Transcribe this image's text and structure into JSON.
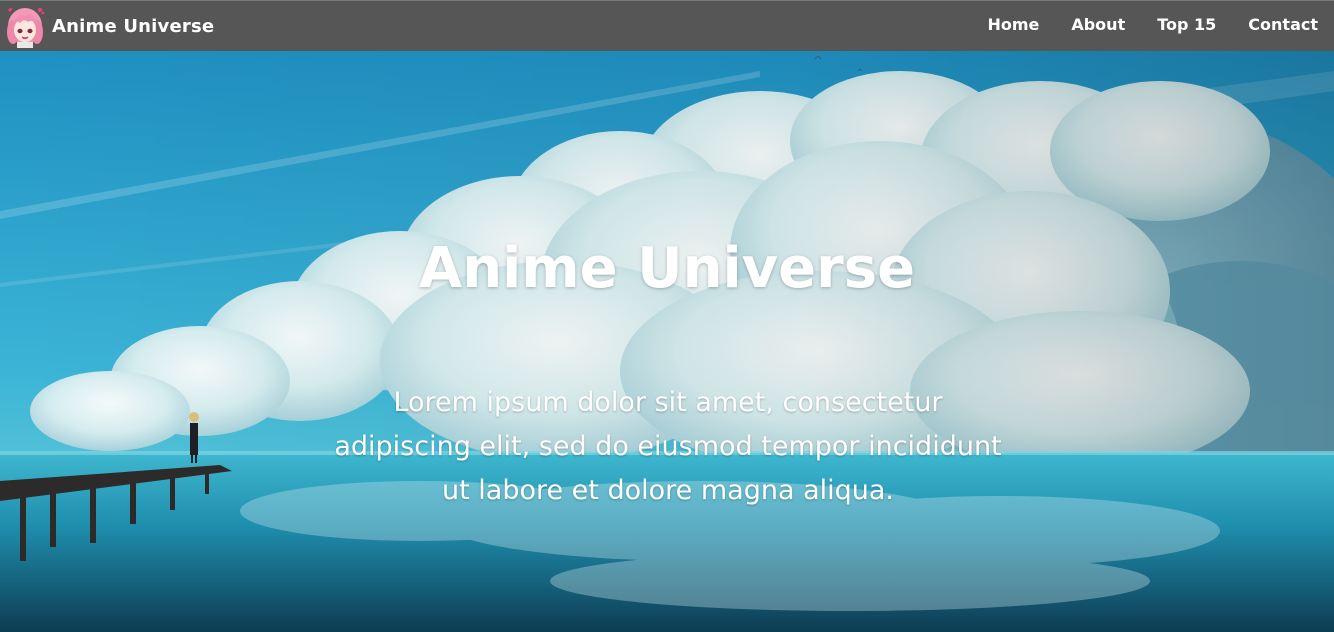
{
  "header": {
    "brand_name": "Anime Universe",
    "logo_icon": "anime-girl-avatar-icon"
  },
  "nav": {
    "items": [
      {
        "label": "Home"
      },
      {
        "label": "About"
      },
      {
        "label": "Top 15"
      },
      {
        "label": "Contact"
      }
    ]
  },
  "hero": {
    "title": "Anime Universe",
    "text": "Lorem ipsum dolor sit amet, consectetur adipiscing elit, sed do eiusmod tempor incididunt ut labore et dolore magna aliqua."
  },
  "colors": {
    "navbar": "#565656",
    "text": "#ffffff",
    "sky": "#2aa0c8",
    "water": "#1a8aa8"
  }
}
